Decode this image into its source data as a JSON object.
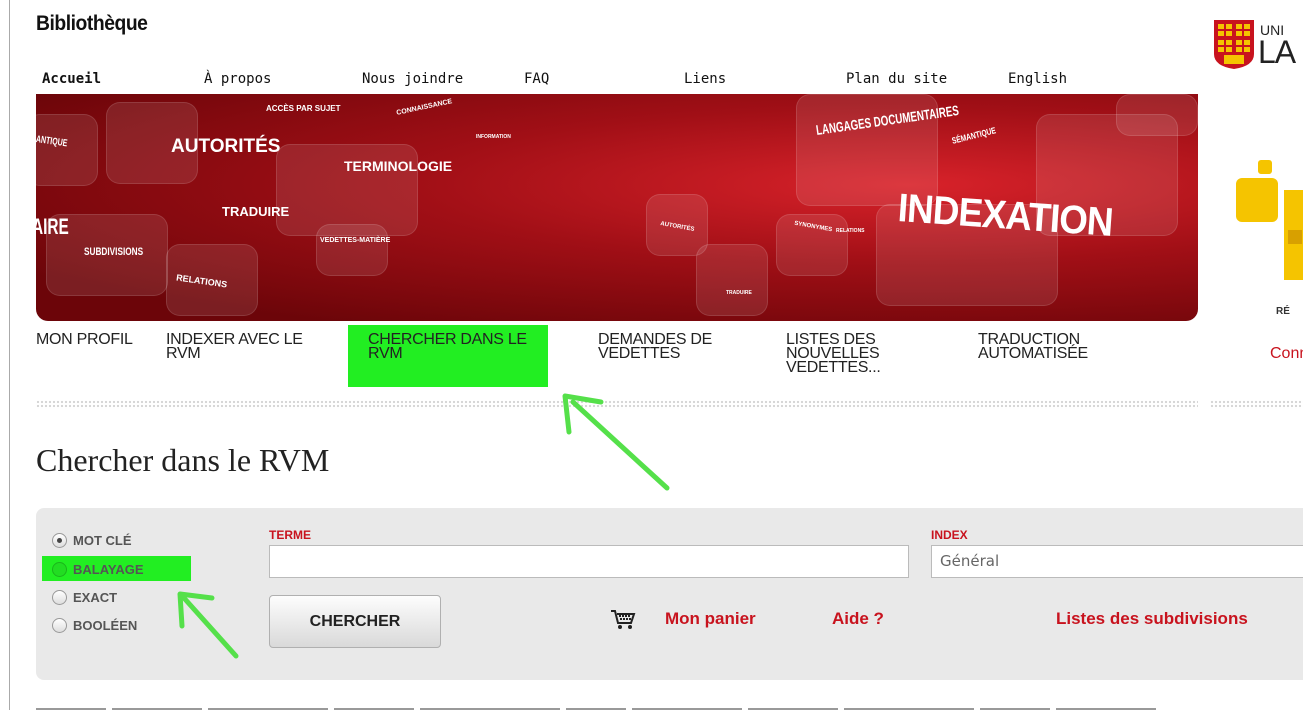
{
  "header": {
    "site_title": "Bibliothèque",
    "logo_text_top": "UNI",
    "logo_text_main": "LA"
  },
  "top_nav": [
    "Accueil",
    "À propos",
    "Nous joindre",
    "FAQ",
    "Liens",
    "Plan du site",
    "English"
  ],
  "banner_words": [
    "ACCÈS PAR SUJET",
    "CONNAISSANCE",
    "AUTORITÉS",
    "TERMINOLOGIE",
    "INFORMATION",
    "TRADUIRE",
    "VEDETTES-MATIÈRE",
    "SUBDIVISIONS",
    "RELATIONS",
    "LANGAGES DOCUMENTAIRES",
    "SÉMANTIQUE",
    "INDEXATION",
    "AUTORITÉS",
    "SYNONYMES",
    "RELATIONS",
    "TRADUIRE",
    "ANTIQUE",
    "AIRE"
  ],
  "category_nav": [
    {
      "label": "MON PROFIL"
    },
    {
      "label": "INDEXER AVEC LE RVM"
    },
    {
      "label": "CHERCHER DANS LE RVM"
    },
    {
      "label": "DEMANDES DE VEDETTES"
    },
    {
      "label": "LISTES DES NOUVELLES VEDETTES..."
    },
    {
      "label": "TRADUCTION AUTOMATISÉE"
    }
  ],
  "connect_label": "Conn",
  "page_title": "Chercher dans le RVM",
  "search": {
    "modes": [
      "MOT CLÉ",
      "BALAYAGE",
      "EXACT",
      "BOOLÉEN"
    ],
    "selected_mode": "MOT CLÉ",
    "term_label": "TERME",
    "term_value": "",
    "index_label": "INDEX",
    "index_value": "Général",
    "search_button": "CHERCHER",
    "cart_label": "Mon panier",
    "help_label": "Aide ?",
    "subdivisions_label": "Listes des subdivisions"
  },
  "colors": {
    "accent_red": "#c8131e",
    "highlight_green": "#22ee22",
    "arrow_green": "#55e04a",
    "banner_red": "#a10f16"
  }
}
